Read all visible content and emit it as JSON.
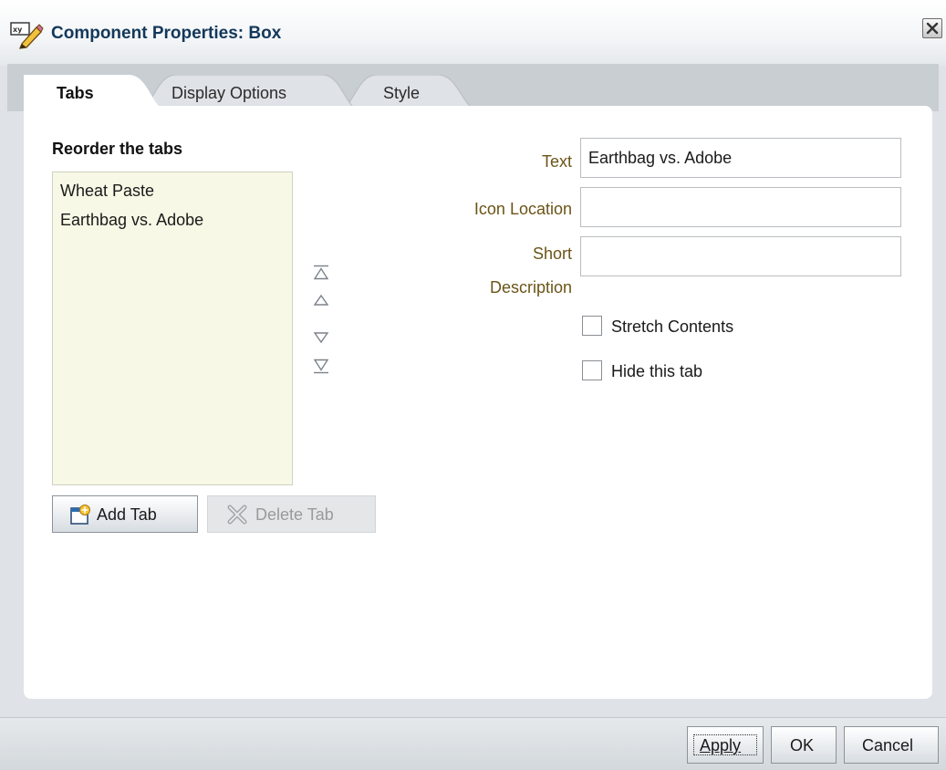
{
  "dialog": {
    "title": "Component Properties: Box",
    "title_icon": "xy-pencil-icon",
    "close_icon": "close-icon"
  },
  "tabs": [
    {
      "label": "Tabs",
      "selected": true
    },
    {
      "label": "Display Options",
      "selected": false
    },
    {
      "label": "Style",
      "selected": false
    }
  ],
  "reorder": {
    "label": "Reorder the tabs",
    "items": [
      "Wheat Paste",
      "Earthbag vs. Adobe"
    ],
    "controls": [
      "move-to-top-icon",
      "move-up-icon",
      "move-down-icon",
      "move-to-bottom-icon"
    ]
  },
  "buttons": {
    "add_tab": "Add Tab",
    "delete_tab": "Delete Tab",
    "apply": "Apply",
    "ok": "OK",
    "cancel": "Cancel"
  },
  "fields": {
    "text_label": "Text",
    "text_value": "Earthbag vs. Adobe",
    "icon_location_label": "Icon Location",
    "icon_location_value": "",
    "short_label": "Short",
    "description_label": "Description",
    "short_description_value": ""
  },
  "checkboxes": {
    "stretch_contents": {
      "label": "Stretch Contents",
      "checked": false
    },
    "hide_tab": {
      "label": "Hide this tab",
      "checked": false
    }
  },
  "colors": {
    "title_text": "#13385a",
    "field_label": "#6b5417",
    "list_background": "#f8f8e6"
  }
}
